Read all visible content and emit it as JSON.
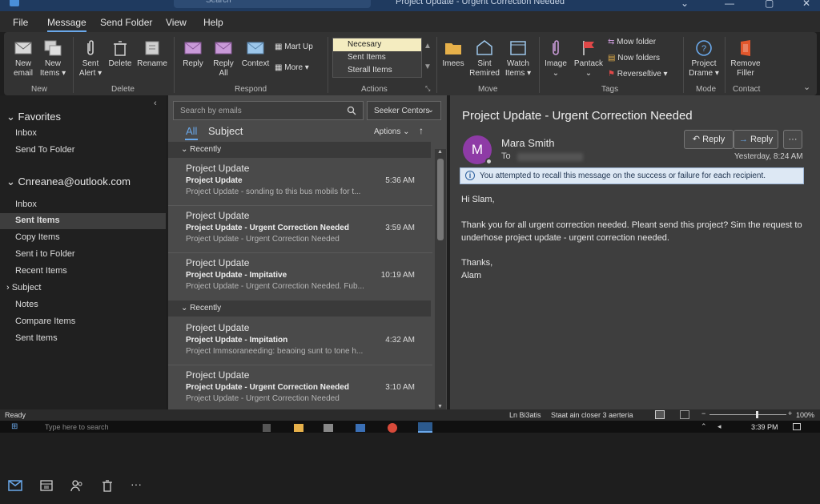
{
  "titlebar": {
    "search_placeholder": "Search",
    "window_title": "Project Update - Urgent Correction Needed"
  },
  "menu": [
    "File",
    "Message",
    "Send Folder",
    "View",
    "Help"
  ],
  "ribbon": {
    "new_email": [
      "New",
      "email"
    ],
    "new_items": [
      "New",
      "Items ▾"
    ],
    "sent_alert": [
      "Sent",
      "Alert ▾"
    ],
    "delete": "Delete",
    "rename": "Rename",
    "reply": "Reply",
    "reply_all": [
      "Reply",
      "All"
    ],
    "context": "Context",
    "mart_up": "Mart Up",
    "more": "More ▾",
    "actions_list": [
      "Necesary",
      "Sent Items",
      "Sterall Items"
    ],
    "imees": "Imees",
    "sint_remired": [
      "Sint",
      "Remired"
    ],
    "watch_items": [
      "Watch",
      "Items ▾"
    ],
    "image": "Image",
    "pantack": "Pantack",
    "mow_folder": "Mow folder",
    "now_folders": "Now folders",
    "reversetive": "Reverseſtive ▾",
    "project_drame": [
      "Project",
      "Drame ▾"
    ],
    "remove_filler": [
      "Remove",
      "Filler"
    ],
    "groups": [
      "New",
      "Delete",
      "Respond",
      "Actions",
      "Move",
      "Tags",
      "Mode",
      "Contact"
    ]
  },
  "sidebar": {
    "favorites": "Favorites",
    "fav_items": [
      "Inbox",
      "Send To Folder"
    ],
    "account": "Cnreanea@outlook.com",
    "items": [
      "Inbox",
      "Sent Items",
      "Copy Items",
      "Sent i to Folder",
      "Recent Items",
      "Subject",
      "Notes",
      "Compare Items",
      "Sent Items"
    ]
  },
  "list": {
    "search_placeholder": "Search by emails",
    "scope": "Seeker Centors",
    "tab_all": "All",
    "tab_subject": "Subject",
    "options": "Aptions",
    "groups": [
      "Recently",
      "Recently"
    ],
    "messages": [
      {
        "from": "Project Update",
        "subject": "Project Update",
        "preview": "Project Update - sonding to this bus mobils for t...",
        "time": "5:36 AM"
      },
      {
        "from": "Project Update",
        "subject": "Project Update - Urgent Correction Needed",
        "preview": "Project Update - Urgent Correction Needed",
        "time": "3:59 AM"
      },
      {
        "from": "Project Update",
        "subject": "Project Update - Impitative",
        "preview": "Project Update - Urgent Correction Needed. Fub...",
        "time": "10:19 AM"
      },
      {
        "from": "Project Update",
        "subject": "Project Update - Impitation",
        "preview": "Project Immsoraneeding: beaoing sunt to tone h...",
        "time": "4:32 AM"
      },
      {
        "from": "Project Update",
        "subject": "Project Update - Urgent Correction Needed",
        "preview": "Project Update - Urgent Correction Needed",
        "time": "3:10 AM"
      }
    ]
  },
  "reading": {
    "subject": "Project Update - Urgent Correction Needed",
    "avatar_letter": "M",
    "sender": "Mara Smith",
    "to_label": "To",
    "reply": "Reply",
    "reply2": "Reply",
    "more": "···",
    "date": "Yesterday, 8:24 AM",
    "info": "You attempted to recall this message on the success or failure for each recipient.",
    "greeting": "Hi Slam,",
    "para": "Thank you for all urgent correction needed. Pleant send this project? Sim the request to underhose project update - urgent correction needed.",
    "thanks": "Thanks,",
    "sign": "Alam"
  },
  "status": {
    "left": "Ready",
    "ln": "Ln Bi3atis",
    "staat": "Staat ain closer 3 aerteria",
    "zoom": "100%",
    "zoom_level": 0.62,
    "time": "3:39 PM",
    "taskbar_search": "Type here to search"
  },
  "colors": {
    "accent": "#6aa8ea",
    "avatar": "#8e3ba6",
    "titlebar": "#1f3a5f"
  }
}
